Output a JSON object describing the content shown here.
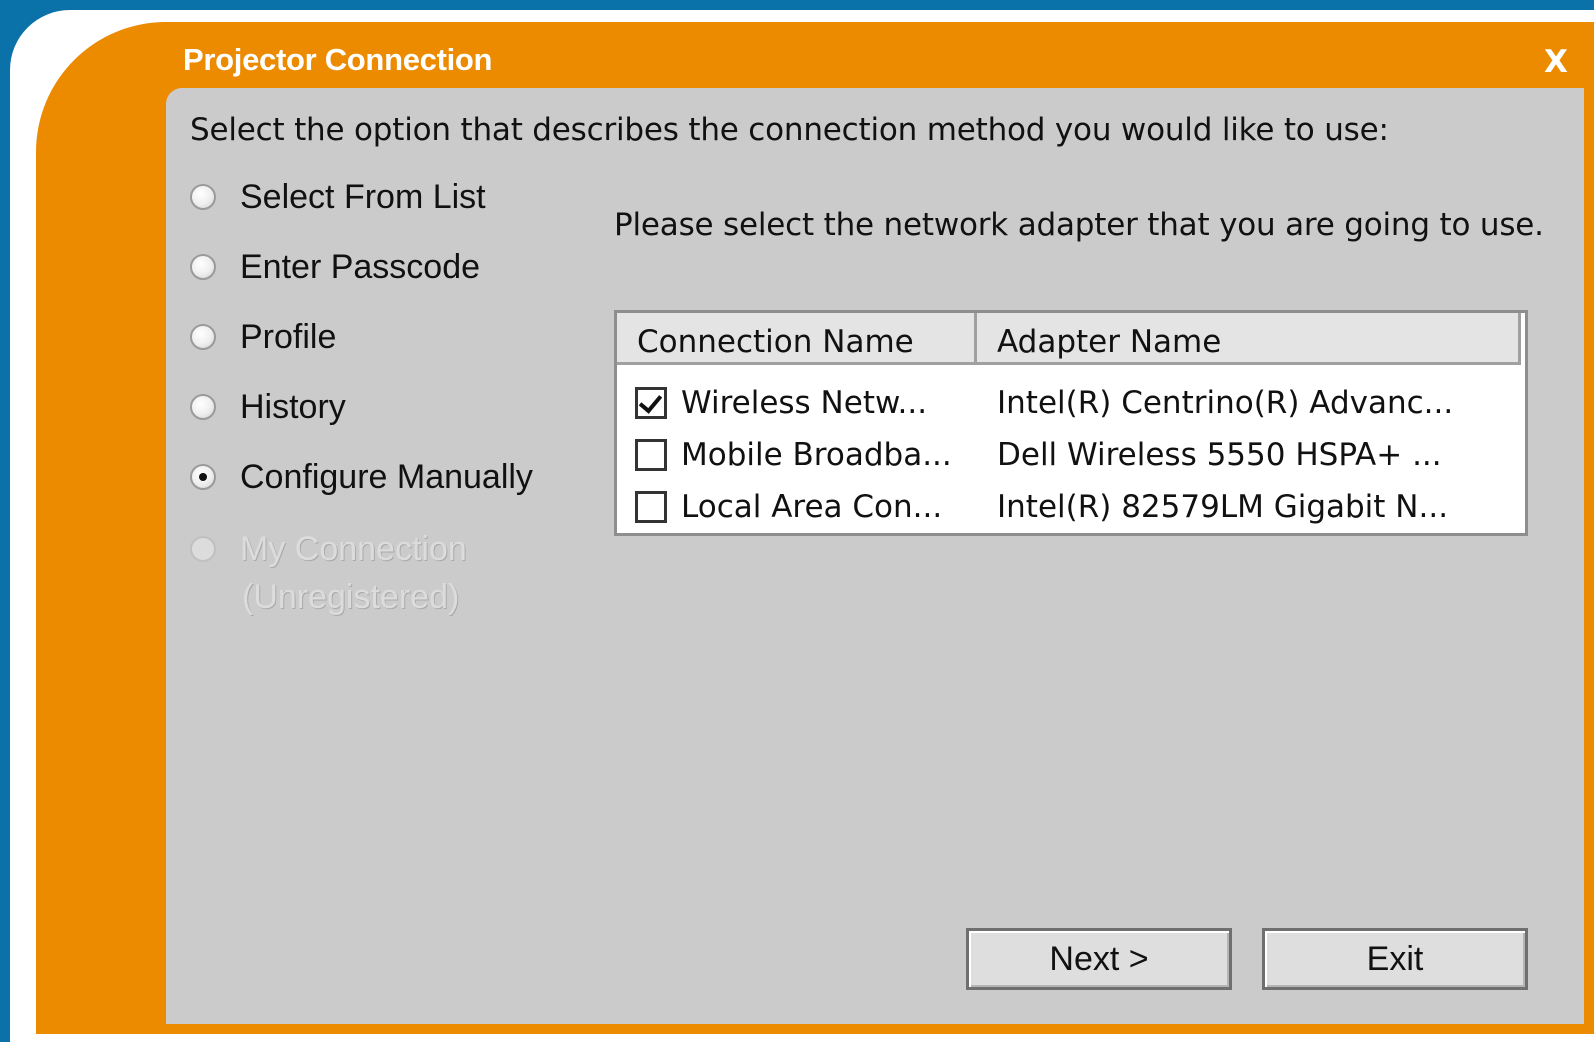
{
  "window": {
    "title": "Projector Connection",
    "close_label": "X"
  },
  "intro_text": "Select the option that describes the connection method you would like to use:",
  "options": [
    {
      "label": "Select From List",
      "selected": false,
      "enabled": true
    },
    {
      "label": "Enter Passcode",
      "selected": false,
      "enabled": true
    },
    {
      "label": "Profile",
      "selected": false,
      "enabled": true
    },
    {
      "label": "History",
      "selected": false,
      "enabled": true
    },
    {
      "label": "Configure Manually",
      "selected": true,
      "enabled": true
    },
    {
      "label": "My Connection",
      "sublabel": "(Unregistered)",
      "selected": false,
      "enabled": false
    }
  ],
  "prompt": "Please select the network adapter that you are going to use.",
  "adapters": {
    "columns": [
      "Connection Name",
      "Adapter Name"
    ],
    "rows": [
      {
        "checked": true,
        "connection": "Wireless Netw...",
        "adapter": "Intel(R) Centrino(R) Advanc..."
      },
      {
        "checked": false,
        "connection": "Mobile Broadba...",
        "adapter": "Dell Wireless 5550 HSPA+ ..."
      },
      {
        "checked": false,
        "connection": "Local Area Con...",
        "adapter": "Intel(R) 82579LM Gigabit N..."
      }
    ]
  },
  "buttons": {
    "next": "Next >",
    "exit": "Exit"
  },
  "colors": {
    "accent": "#ec8a00",
    "desktop": "#0a72a8",
    "panel": "#cbcbcb"
  }
}
